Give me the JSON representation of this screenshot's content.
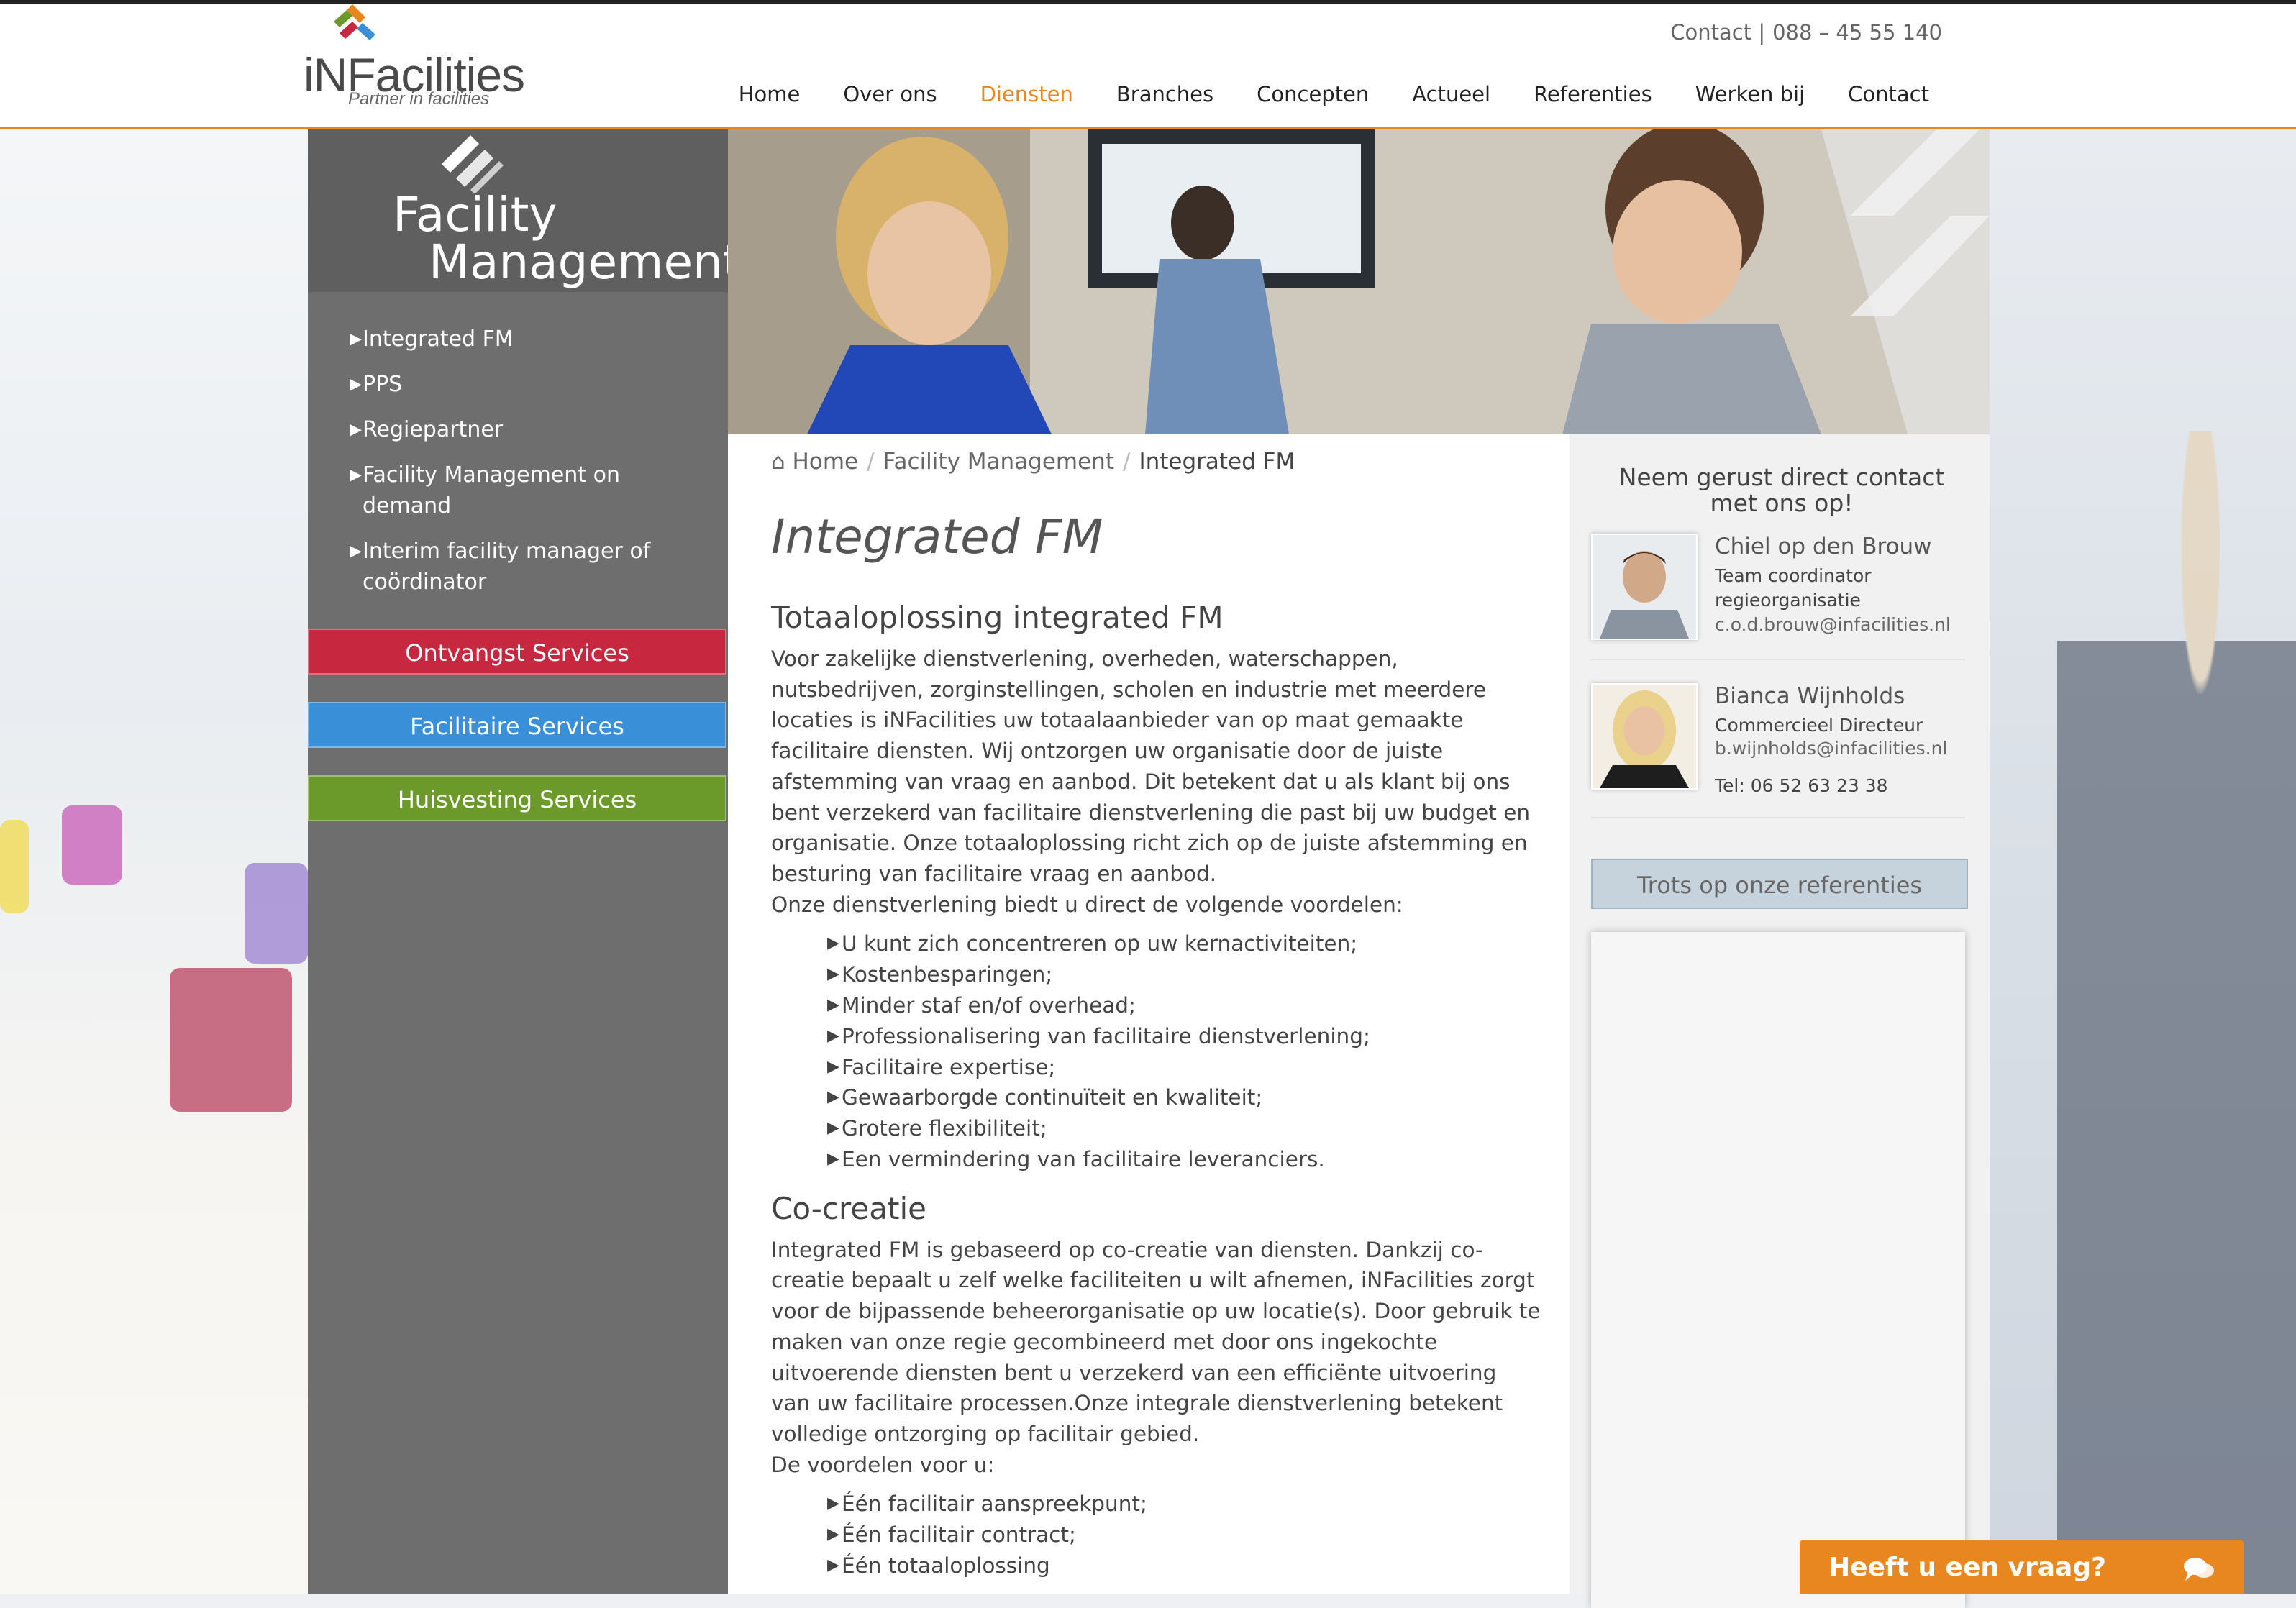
{
  "header": {
    "logo_text": "iNFacilities",
    "logo_tagline": "Partner in facilities",
    "contact_label": "Contact |",
    "phone": "088 – 45 55 140",
    "nav": [
      "Home",
      "Over ons",
      "Diensten",
      "Branches",
      "Concepten",
      "Actueel",
      "Referenties",
      "Werken bij",
      "Contact"
    ],
    "active_nav": "Diensten"
  },
  "sidebar": {
    "title_line1": "Facility",
    "title_line2": "Management",
    "menu": [
      "Integrated FM",
      "PPS",
      "Regiepartner",
      "Facility Management on demand",
      "Interim facility manager of coördinator"
    ],
    "services": [
      "Ontvangst Services",
      "Facilitaire Services",
      "Huisvesting Services"
    ]
  },
  "breadcrumb": {
    "home": "Home",
    "section": "Facility Management",
    "current": "Integrated FM"
  },
  "main": {
    "title": "Integrated FM",
    "section1_heading": "Totaaloplossing integrated FM",
    "section1_text": "Voor zakelijke dienstverlening, overheden, waterschappen, nutsbedrijven, zorginstellingen, scholen en industrie met meerdere locaties is iNFacilities uw totaalaanbieder van op maat gemaakte facilitaire diensten. Wij ontzorgen uw organisatie door de juiste afstemming van vraag en aanbod. Dit betekent dat u als klant bij ons bent verzekerd van facilitaire dienstverlening die past bij uw budget en organisatie. Onze totaaloplossing richt zich op de juiste afstemming en besturing van facilitaire vraag en aanbod.",
    "section1_intro": "Onze dienstverlening biedt u direct de volgende voordelen:",
    "section1_list": [
      "U kunt zich concentreren op uw kernactiviteiten;",
      "Kostenbesparingen;",
      "Minder staf en/of overhead;",
      "Professionalisering van facilitaire dienstverlening;",
      "Facilitaire expertise;",
      "Gewaarborgde continuïteit en kwaliteit;",
      "Grotere flexibiliteit;",
      "Een vermindering van facilitaire leveranciers."
    ],
    "section2_heading": "Co-creatie",
    "section2_text": "Integrated FM is gebaseerd op co-creatie van diensten. Dankzij co-creatie bepaalt u zelf welke faciliteiten u wilt afnemen, iNFacilities zorgt voor de bijpassende beheerorganisatie op uw locatie(s). Door gebruik te maken van onze regie gecombineerd met door ons ingekochte uitvoerende diensten bent u verzekerd van een efficiënte uitvoering van uw facilitaire processen.Onze integrale dienstverlening betekent volledige ontzorging op facilitair gebied.",
    "section2_intro": "De voordelen voor u:",
    "section2_list": [
      "Één facilitair aanspreekpunt;",
      "Één facilitair contract;",
      "Één totaaloplossing"
    ]
  },
  "aside": {
    "title": "Neem gerust direct contact met ons op!",
    "contacts": [
      {
        "name": "Chiel op den Brouw",
        "role": "Team coordinator regieorganisatie",
        "email": "c.o.d.brouw@infacilities.nl"
      },
      {
        "name": "Bianca Wijnholds",
        "role": "Commercieel Directeur",
        "email": "b.wijnholds@infacilities.nl",
        "tel": "Tel: 06 52 63 23 38"
      }
    ],
    "references_button": "Trots op onze referenties"
  },
  "chat": {
    "label": "Heeft u een vraag?"
  },
  "colors": {
    "accent": "#e8861f",
    "sidebar": "#6e6e6e",
    "red": "#c8283f",
    "blue": "#3a8fd9",
    "green": "#6b9a2a"
  }
}
